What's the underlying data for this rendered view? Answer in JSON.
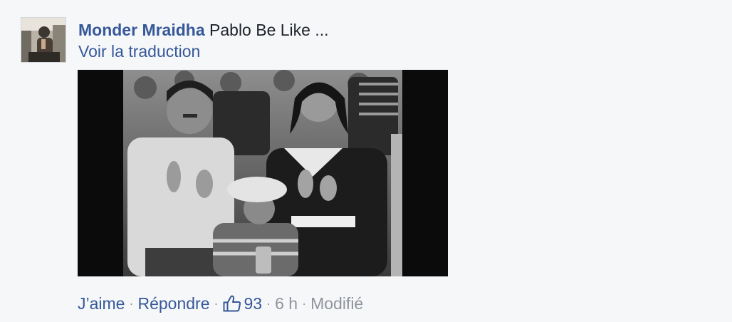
{
  "comment": {
    "author": "Monder Mraidha",
    "text": "Pablo Be Like ...",
    "translate_label": "Voir la traduction",
    "actions": {
      "like_label": "J’aime",
      "reply_label": "Répondre",
      "like_count": "93",
      "time": "6 h",
      "edited_label": "Modifié",
      "separator": "·"
    },
    "icons": {
      "like": "thumbs-up-icon"
    },
    "colors": {
      "link": "#365899",
      "muted": "#90949c",
      "text": "#1d2129",
      "background": "#f6f7f9"
    }
  }
}
